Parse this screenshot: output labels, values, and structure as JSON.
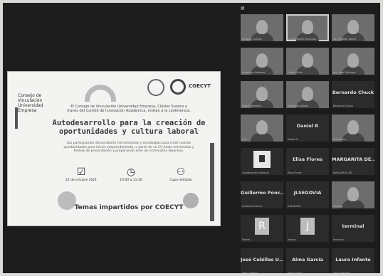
{
  "slide": {
    "university": "Consejo de Vinculación Universidad Empresa",
    "intro": "El Consejo de Vinculación Universidad Empresa, Clúster Sonora a través del Comité de Innovación Académica, invitan a la conferencia:",
    "title": "Autodesarrollo para la creación de oportunidades y cultura laboral",
    "description": "Los participantes desarrollarán herramientas y estrategias para crear nuevas oportunidades para iniciar emprendimiento, a partir de su CV hasta entrevistas y formas de presentación y preparación ante las entrevistas laborales.",
    "date": "12 de octubre 2021",
    "time": "10:00 a 11:30",
    "cupo": "Cupo limitado",
    "footer": "Temas impartidos por COECYT",
    "coecyt_logo": "COECYT"
  },
  "gallery": {
    "tiles": [
      {
        "name": "",
        "label": "Antonio Cuevas",
        "kind": "video"
      },
      {
        "name": "",
        "label": "Coordinación Ejecutiva",
        "kind": "video",
        "highlight": true
      },
      {
        "name": "",
        "label": "Lic. Cristian Neyra",
        "kind": "video"
      },
      {
        "name": "",
        "label": "Alejandra Vázquez",
        "kind": "video"
      },
      {
        "name": "",
        "label": "Daniel Ortiz",
        "kind": "video"
      },
      {
        "name": "",
        "label": "Ing. Juan Gallegos",
        "kind": "video"
      },
      {
        "name": "",
        "label": "Isabel Montaño",
        "kind": "video"
      },
      {
        "name": "",
        "label": "Giovanna Valdez",
        "kind": "video"
      },
      {
        "name": "Bernardo Chuck",
        "label": "Bernardo Chuck",
        "kind": "name"
      },
      {
        "name": "",
        "label": "Ana",
        "kind": "video"
      },
      {
        "name": "Daniel R",
        "label": "Daniel R",
        "kind": "name"
      },
      {
        "name": "",
        "label": "Ana Karen",
        "kind": "video"
      },
      {
        "name": "",
        "label": "Coordinación General",
        "kind": "logo"
      },
      {
        "name": "Elisa Flores",
        "label": "Elisa Flores",
        "kind": "name"
      },
      {
        "name": "MARGARITA DE...",
        "label": "MARGARITA DE",
        "kind": "name"
      },
      {
        "name": "Guillermo Ponc...",
        "label": "Guillermo Ponce",
        "kind": "name"
      },
      {
        "name": "JLSEGOVIA",
        "label": "JLSEGOVIA",
        "kind": "name"
      },
      {
        "name": "",
        "label": "Horacio",
        "kind": "video"
      },
      {
        "name": "",
        "label": "Rafael",
        "kind": "avatar",
        "letter": "R"
      },
      {
        "name": "",
        "label": "Jessica",
        "kind": "avatar",
        "letter": "J"
      },
      {
        "name": "terminal",
        "label": "terminal",
        "kind": "name"
      },
      {
        "name": "José Cubillas U...",
        "label": "José Cubillas",
        "kind": "name"
      },
      {
        "name": "Alma García",
        "label": "Alma García",
        "kind": "name"
      },
      {
        "name": "Laura Infante",
        "label": "Laura Infante",
        "kind": "name"
      }
    ]
  }
}
